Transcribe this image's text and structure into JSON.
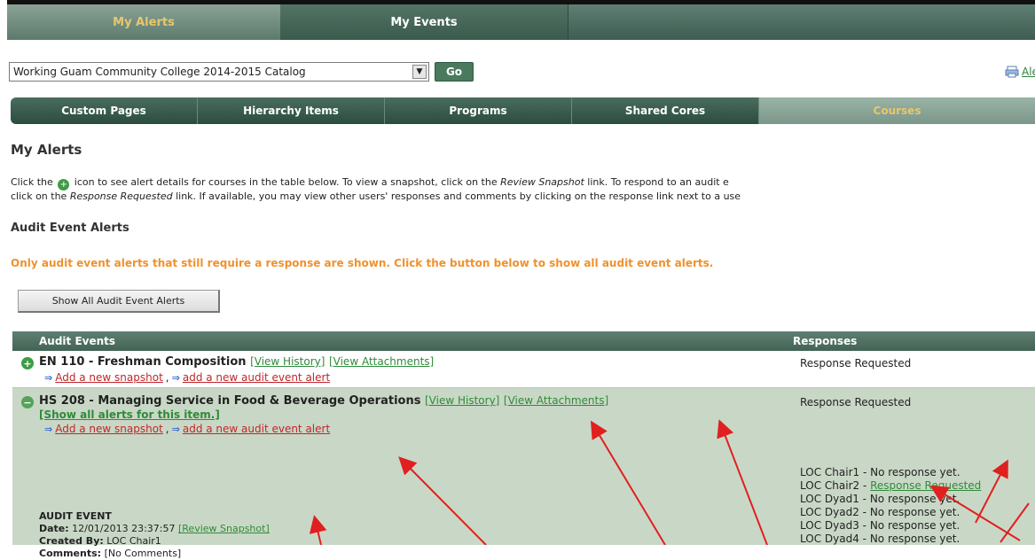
{
  "top_tabs": [
    "My Alerts",
    "My Events"
  ],
  "catalog_select": {
    "selected": "Working Guam Community College 2014-2015 Catalog",
    "go_label": "Go"
  },
  "alerts_link": "Ale",
  "sub_nav": [
    "Custom Pages",
    "Hierarchy Items",
    "Programs",
    "Shared Cores",
    "Courses"
  ],
  "page_title": "My Alerts",
  "intro": {
    "line1_pre": "Click the",
    "line1_post": "icon to see alert details for courses in the table below. To view a snapshot, click on the",
    "review_snapshot": "Review Snapshot",
    "line1_tail": "link. To respond to an audit e",
    "line2_pre": "click on the",
    "response_requested": "Response Requested",
    "line2_post": "link. If available, you may view other users' responses and comments by clicking on the response link next to a use"
  },
  "section_title": "Audit Event Alerts",
  "warning": "Only audit event alerts that still require a response are shown. Click the button below to show all audit event alerts.",
  "show_all_button": "Show All Audit Event Alerts",
  "table": {
    "col_events": "Audit Events",
    "col_responses": "Responses",
    "rows": [
      {
        "title": "EN 110 - Freshman Composition",
        "view_history": "[View History]",
        "view_attachments": "[View Attachments]",
        "add_snapshot": "Add a new snapshot",
        "add_alert": "add a new audit event alert",
        "response": "Response Requested"
      },
      {
        "title": "HS 208 - Managing Service in Food & Beverage Operations",
        "view_history": "[View History]",
        "view_attachments": "[View Attachments]",
        "show_all_alerts": "[Show all alerts for this item.]",
        "add_snapshot": "Add a new snapshot",
        "add_alert": "add a new audit event alert",
        "response": "Response Requested",
        "event": {
          "heading": "AUDIT EVENT",
          "date_label": "Date:",
          "date_value": "12/01/2013 23:37:57",
          "review_snapshot": "[Review Snapshot]",
          "created_label": "Created By:",
          "created_value": "LOC Chair1",
          "comments_label": "Comments:",
          "comments_value": "[No Comments]"
        },
        "responders": [
          {
            "name": "LOC Chair1",
            "status": "No response yet."
          },
          {
            "name": "LOC Chair2",
            "status": "Response Requested",
            "is_link": true
          },
          {
            "name": "LOC Dyad1",
            "status": "No response yet."
          },
          {
            "name": "LOC Dyad2",
            "status": "No response yet."
          },
          {
            "name": "LOC Dyad3",
            "status": "No response yet."
          },
          {
            "name": "LOC Dyad4",
            "status": "No response yet."
          }
        ]
      }
    ]
  },
  "colors": {
    "accent_green": "#3e9c45",
    "warning_orange": "#f0912c",
    "annotation_red": "#e02020",
    "active_tab_text": "#e9c76a"
  }
}
